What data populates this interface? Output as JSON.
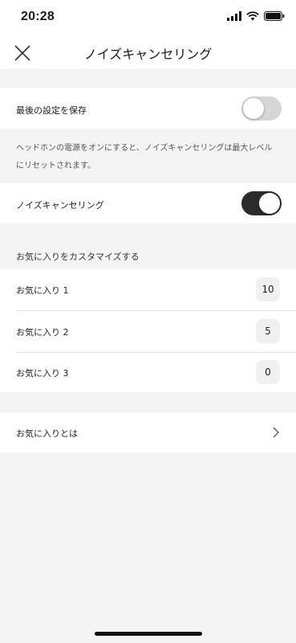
{
  "status_bar": {
    "time": "20:28",
    "icons": [
      "signal-icon",
      "wifi-icon",
      "battery-icon"
    ]
  },
  "header": {
    "title": "ノイズキャンセリング",
    "close_icon": "close-icon"
  },
  "settings": {
    "save_last": {
      "label": "最後の設定を保存",
      "enabled": false
    },
    "note": "ヘッドホンの電源をオンにすると、ノイズキャンセリングは最大レベルにリセットされます。",
    "noise_cancel": {
      "label": "ノイズキャンセリング",
      "enabled": true
    }
  },
  "favorites": {
    "header": "お気に入りをカスタマイズする",
    "items": [
      {
        "label": "お気に入り 1",
        "value": "10"
      },
      {
        "label": "お気に入り 2",
        "value": "5"
      },
      {
        "label": "お気に入り 3",
        "value": "0"
      }
    ]
  },
  "about": {
    "label": "お気に入りとは",
    "icon": "chevron-right-icon"
  },
  "colors": {
    "toggle_on": "#2b2b2b",
    "toggle_off": "#d6d6d6",
    "background": "#f4f4f4",
    "row": "#ffffff"
  }
}
